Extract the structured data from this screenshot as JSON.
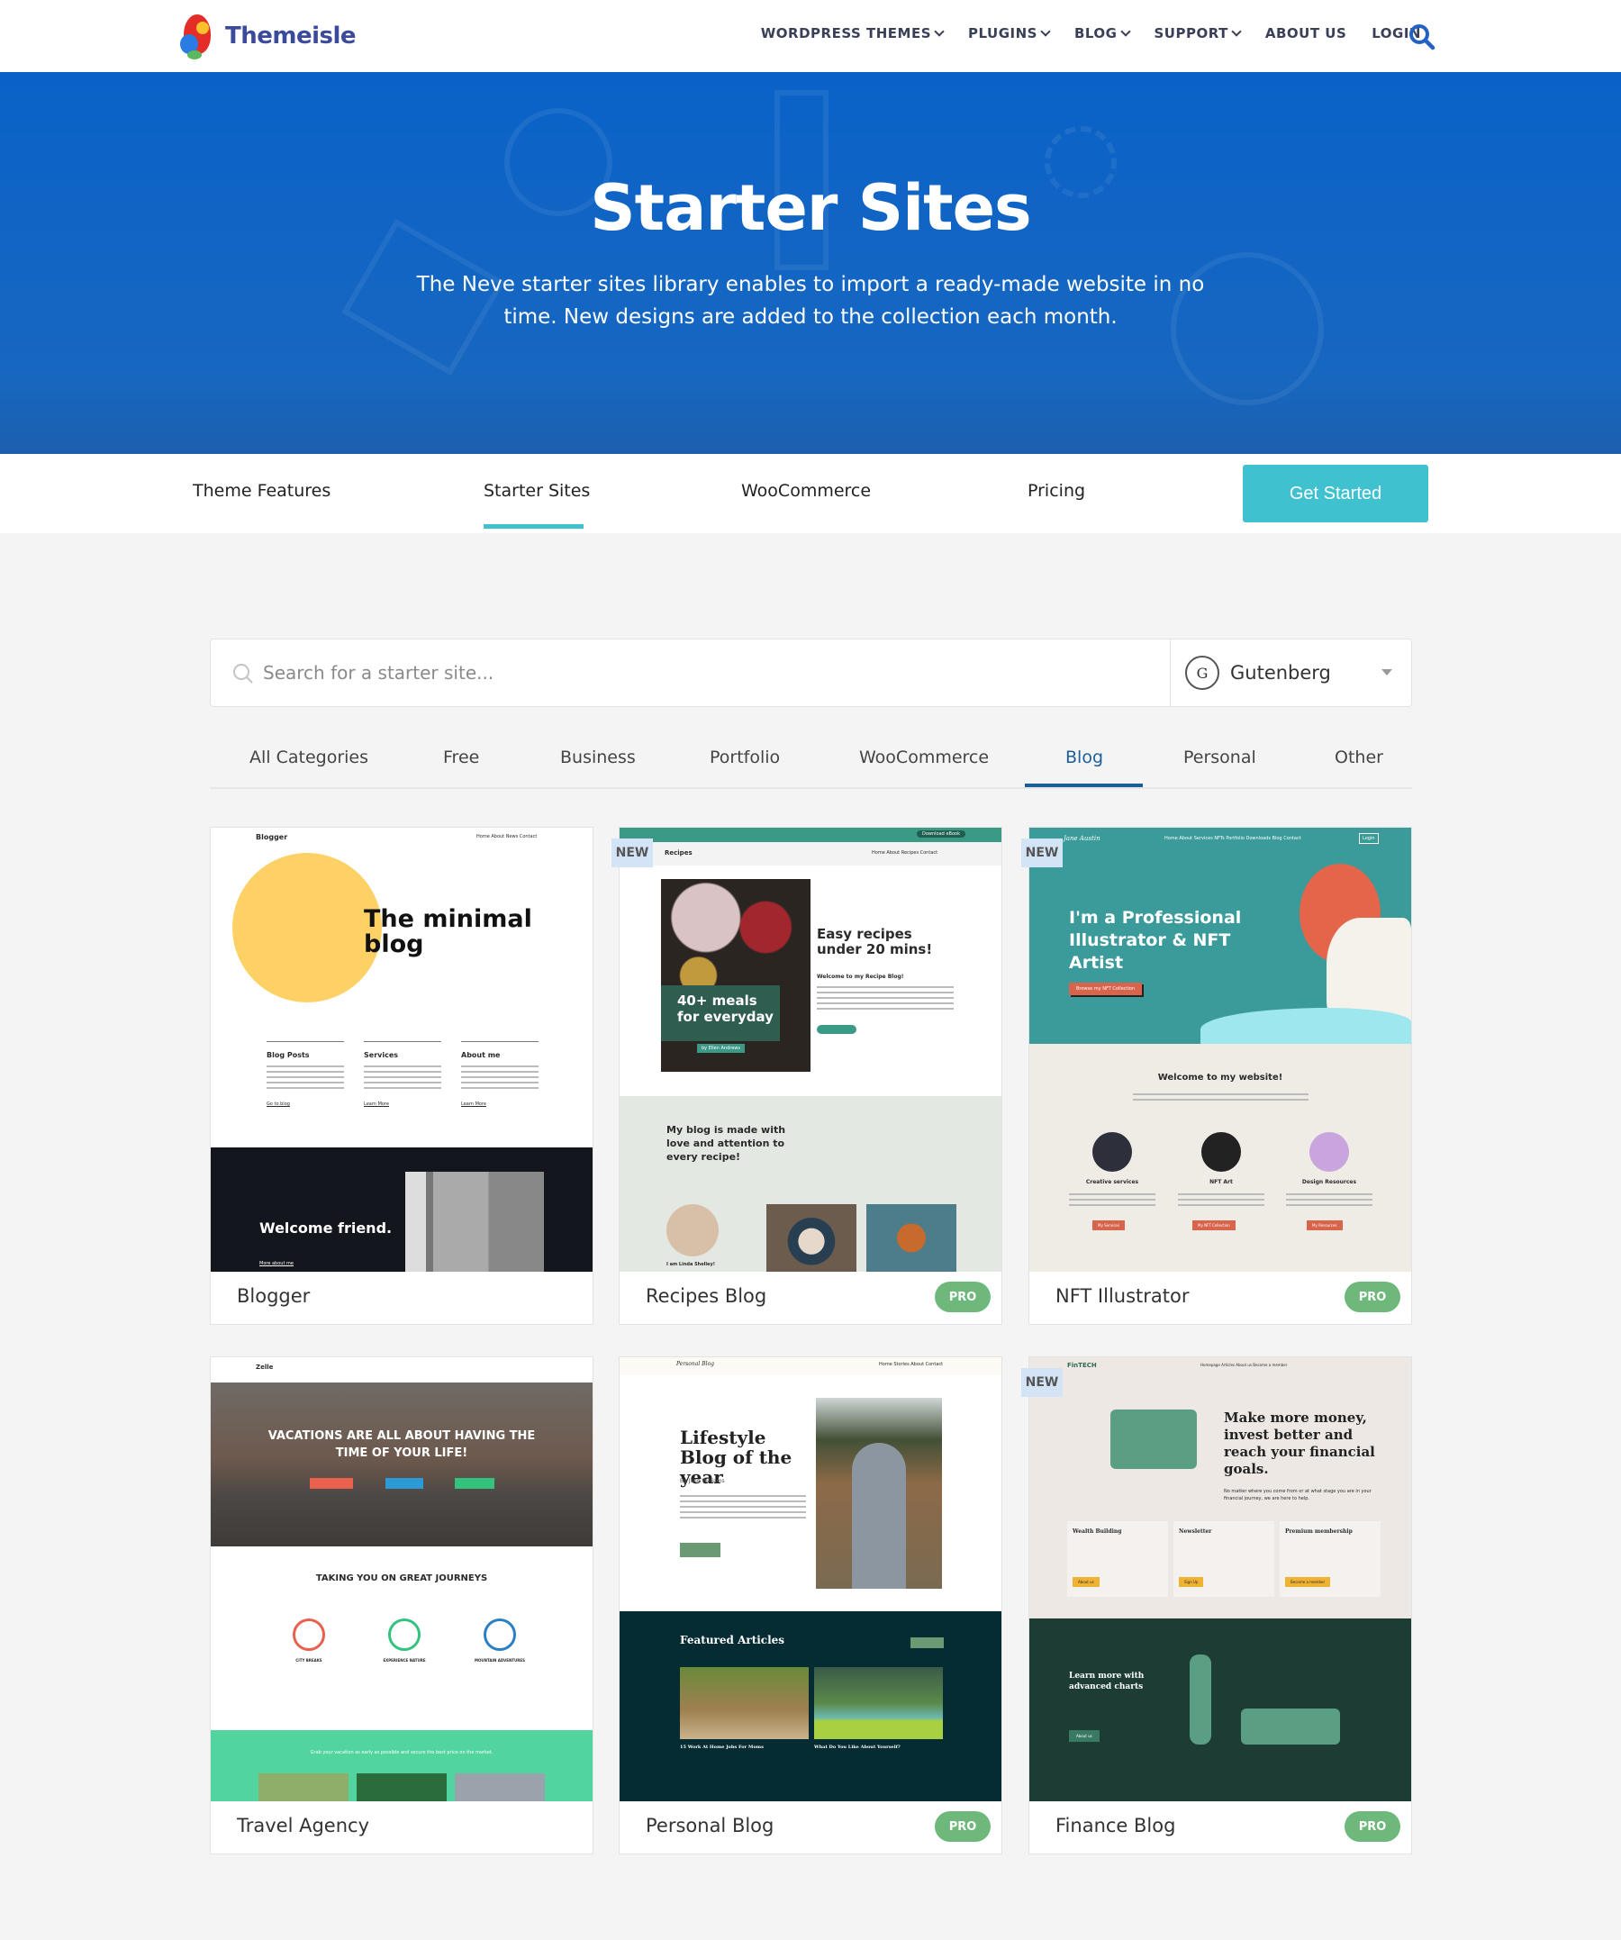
{
  "header": {
    "logo": "Themeisle",
    "nav": [
      "WORDPRESS THEMES",
      "PLUGINS",
      "BLOG",
      "SUPPORT",
      "ABOUT US",
      "LOGIN"
    ],
    "search_icon": "search-icon"
  },
  "hero": {
    "title": "Starter Sites",
    "subtitle": "The Neve starter sites library enables to import a ready-made website in no time. New designs are added to the collection each month."
  },
  "subnav": {
    "items": [
      "Theme Features",
      "Starter Sites",
      "WooCommerce",
      "Pricing"
    ],
    "active": "Starter Sites",
    "cta": "Get Started"
  },
  "search": {
    "placeholder": "Search for a starter site...",
    "value": "",
    "builder": "Gutenberg"
  },
  "categories": {
    "items": [
      "All Categories",
      "Free",
      "Business",
      "Portfolio",
      "WooCommerce",
      "Blog",
      "Personal",
      "Other"
    ],
    "active": "Blog"
  },
  "colors": {
    "brand_blue": "#0a62c8",
    "teal": "#40c1cf",
    "pro_green": "#6db87a",
    "new_badge": "#d4e4f7",
    "active_tab": "#1a5e9a"
  },
  "badges": {
    "new": "NEW",
    "pro": "PRO"
  },
  "cards": [
    {
      "title": "Blogger",
      "is_new": false,
      "is_pro": false,
      "preview": {
        "brand": "Blogger",
        "nav": "Home  About  News  Contact",
        "headline": "The minimal blog",
        "cols": [
          "Blog Posts",
          "Services",
          "About me"
        ],
        "links": [
          "Go to blog",
          "Learn More",
          "Learn More"
        ],
        "dark_title": "Welcome friend.",
        "dark_link": "More about me"
      }
    },
    {
      "title": "Recipes Blog",
      "is_new": true,
      "is_pro": true,
      "preview": {
        "topbar_btn": "Download eBook",
        "brand": "Recipes",
        "nav": "Home  About  Recipes  Contact",
        "overlay": "40+ meals for everyday",
        "byline": "by Ellen Andrews",
        "headline": "Easy recipes under 20 mins!",
        "welcome": "Welcome to my Recipe Blog!",
        "section": "My blog is made with love and attention to every recipe!",
        "name": "I am Linda Shelley!"
      }
    },
    {
      "title": "NFT Illustrator",
      "is_new": true,
      "is_pro": true,
      "preview": {
        "brand": "Jane Austin",
        "nav": "Home  About  Services  NFTs  Portfolio  Downloads  Blog  Contact",
        "login": "Login",
        "headline": "I'm a Professional Illustrator & NFT Artist",
        "cta": "Browse my NFT Collection",
        "welcome": "Welcome to my website!",
        "cols": [
          "Creative services",
          "NFT Art",
          "Design Resources"
        ],
        "buttons": [
          "My Services",
          "My NFT Collection",
          "My Resources"
        ]
      }
    },
    {
      "title": "Travel Agency",
      "is_new": false,
      "is_pro": false,
      "preview": {
        "brand": "Zelle",
        "headline": "VACATIONS ARE ALL ABOUT HAVING THE TIME OF YOUR LIFE!",
        "section": "TAKING YOU ON GREAT JOURNEYS",
        "cols": [
          "CITY BREAKS",
          "EXPERIENCE NATURE",
          "MOUNTAIN ADVENTURES"
        ],
        "band": "Grab your vacation as early as possible and secure the best price on the market."
      }
    },
    {
      "title": "Personal Blog",
      "is_new": false,
      "is_pro": true,
      "preview": {
        "brand": "Personal Blog",
        "nav": "Home  Stories  About  Contact",
        "headline": "Lifestyle Blog of the year",
        "byline": "By Jane Williams",
        "section": "Featured Articles",
        "articles": [
          "15 Work At Home Jobs For Moms",
          "What Do You Like About Yourself?"
        ]
      }
    },
    {
      "title": "Finance Blog",
      "is_new": true,
      "is_pro": true,
      "preview": {
        "brand": "FinTECH",
        "nav": "Homepage  Articles  About us  Become a member",
        "headline": "Make more money, invest better and reach your financial goals.",
        "sub": "No matter where you come from or at what stage you are in your financial journey, we are here to help.",
        "cols": [
          "Wealth Building",
          "Newsletter",
          "Premium membership"
        ],
        "buttons": [
          "About us",
          "Sign Up",
          "Become a member"
        ],
        "dark_title": "Learn more with advanced charts",
        "dark_btn": "About us"
      }
    }
  ]
}
